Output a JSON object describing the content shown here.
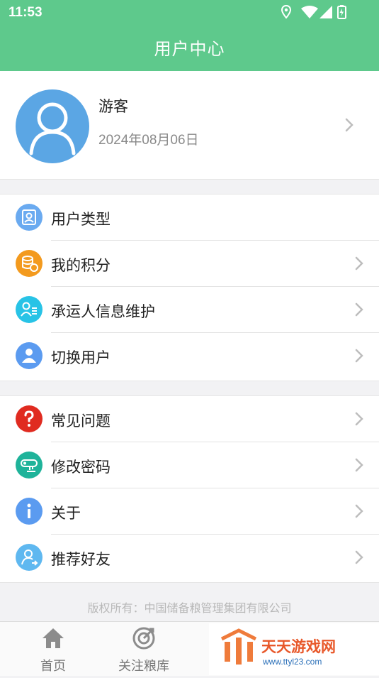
{
  "status_bar": {
    "time": "11:53"
  },
  "header": {
    "title": "用户中心"
  },
  "profile": {
    "name": "游客",
    "date": "2024年08月06日"
  },
  "group1": [
    {
      "label": "用户类型",
      "icon": "user-type-icon",
      "color": "#6aaaf0",
      "chevron": false
    },
    {
      "label": "我的积分",
      "icon": "coins-icon",
      "color": "#f39a1e",
      "chevron": true
    },
    {
      "label": "承运人信息维护",
      "icon": "carrier-info-icon",
      "color": "#28c3e6",
      "chevron": true
    },
    {
      "label": "切换用户",
      "icon": "switch-user-icon",
      "color": "#5b9bf0",
      "chevron": true
    }
  ],
  "group2": [
    {
      "label": "常见问题",
      "icon": "question-icon",
      "color": "#e02b20",
      "chevron": true
    },
    {
      "label": "修改密码",
      "icon": "key-icon",
      "color": "#1fb39a",
      "chevron": true
    },
    {
      "label": "关于",
      "icon": "info-icon",
      "color": "#5b9bf0",
      "chevron": true
    },
    {
      "label": "推荐好友",
      "icon": "recommend-friend-icon",
      "color": "#5fb8f0",
      "chevron": true
    }
  ],
  "footer": {
    "copyright": "版权所有：中国储备粮管理集团有限公司"
  },
  "tabbar": [
    {
      "label": "首页",
      "icon": "home-icon"
    },
    {
      "label": "关注粮库",
      "icon": "target-icon"
    }
  ],
  "watermark": {
    "brand": "天天游戏网",
    "url": "www.ttyl23.com"
  },
  "theme": {
    "primary": "#5ec98c"
  }
}
